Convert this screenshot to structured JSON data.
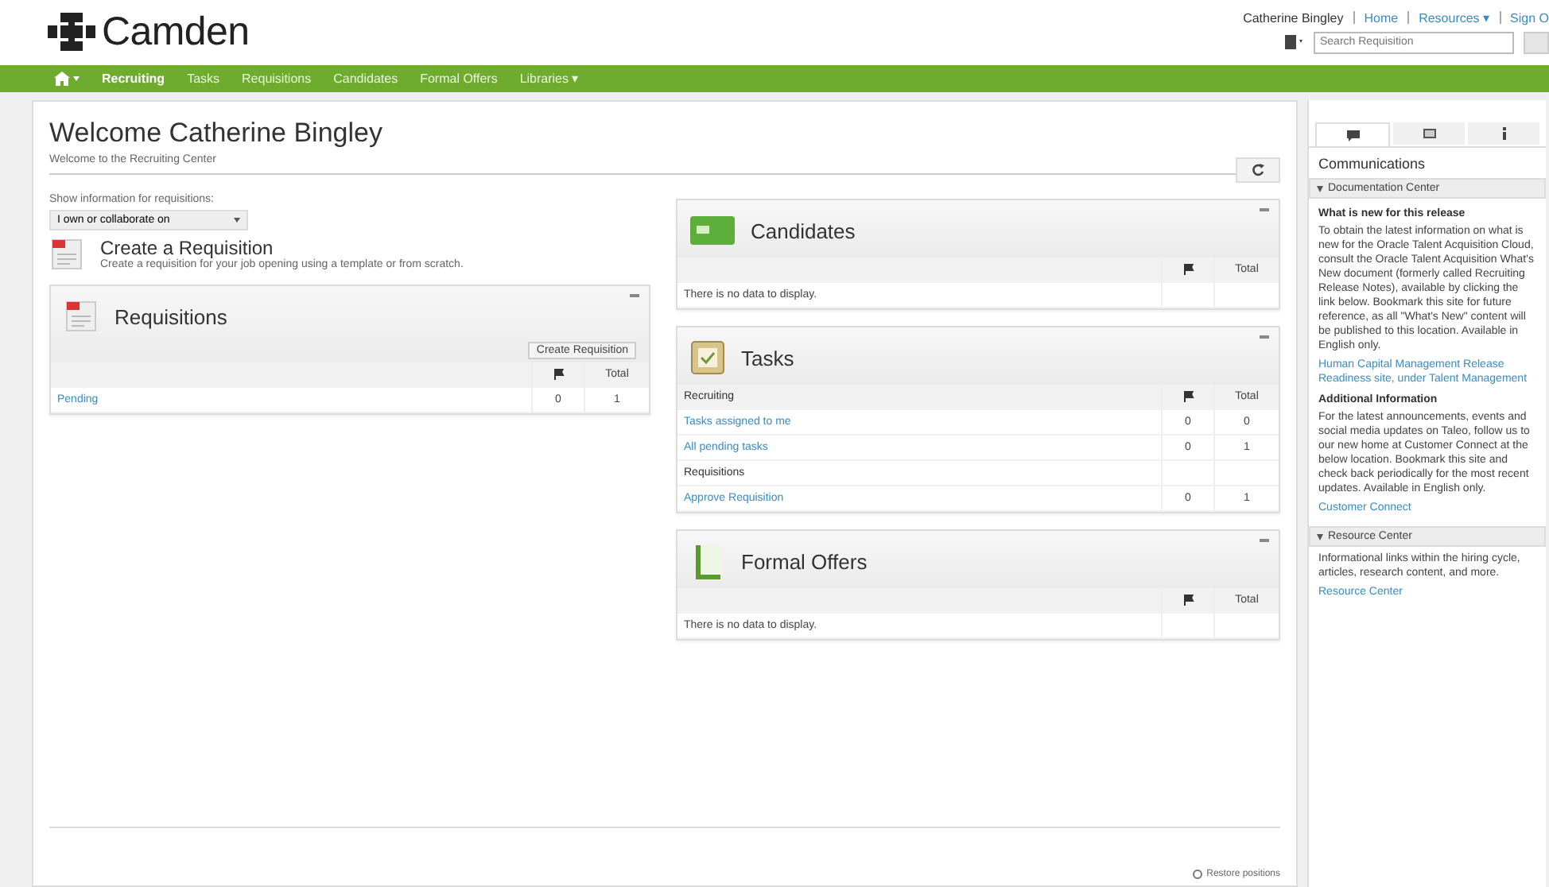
{
  "header": {
    "logo": "Camden",
    "user": "Catherine Bingley",
    "links": [
      "Home",
      "Resources ▾",
      "Sign O"
    ],
    "search": {
      "placeholder": "Search Requisition"
    }
  },
  "nav": [
    {
      "label": "Recruiting",
      "selected": true
    },
    {
      "label": "Tasks",
      "selected": false
    },
    {
      "label": "Requisitions",
      "selected": false
    },
    {
      "label": "Candidates",
      "selected": false
    },
    {
      "label": "Formal Offers",
      "selected": false
    },
    {
      "label": "Libraries ▾",
      "selected": false
    }
  ],
  "page": {
    "title": "Welcome Catherine Bingley",
    "subtitle": "Welcome to the Recruiting Center",
    "filter_label": "Show information for requisitions:",
    "filter_value": "I own or collaborate on",
    "create_title": "Create a Requisition",
    "create_description": "Create a requisition for your job opening using a template or from scratch.",
    "footer_link": "Restore positions"
  },
  "left_widgets": [
    {
      "kind": "requisitions",
      "title": "Requisitions",
      "action": "Create Requisition",
      "total_label": "Total",
      "rows": [
        {
          "kind": "link",
          "label": "Pending",
          "cells": [
            "0",
            "1"
          ]
        }
      ]
    }
  ],
  "right_widgets": [
    {
      "kind": "candidates",
      "title": "Candidates",
      "total_label": "Total",
      "empty_text": "There is no data to display."
    },
    {
      "kind": "tasks",
      "title": "Tasks",
      "total_label": "Total",
      "rows": [
        {
          "kind": "group",
          "label": "Recruiting"
        },
        {
          "kind": "link",
          "label": "Tasks assigned to me",
          "cells": [
            "0",
            "0"
          ]
        },
        {
          "kind": "link",
          "label": "All pending tasks",
          "cells": [
            "0",
            "1"
          ]
        },
        {
          "kind": "group",
          "label": "Requisitions"
        },
        {
          "kind": "link",
          "label": "Approve Requisition",
          "cells": [
            "0",
            "1"
          ]
        }
      ]
    },
    {
      "kind": "offers",
      "title": "Formal Offers",
      "total_label": "Total",
      "empty_text": "There is no data to display."
    }
  ],
  "sidebar": {
    "tabs": [
      {
        "kind": "chat",
        "selected": true
      },
      {
        "kind": "video",
        "selected": false
      },
      {
        "kind": "info",
        "selected": false
      }
    ],
    "title": "Communications",
    "sections": [
      {
        "title": "Documentation Center",
        "expanded": true,
        "blocks": [
          {
            "kind": "heading",
            "text": "What is new for this release"
          },
          {
            "kind": "text",
            "text": "To obtain the latest information on what is new for the Oracle Talent Acquisition Cloud, consult the Oracle Talent Acquisition What's New document (formerly called Recruiting Release Notes), available by clicking the link below. Bookmark this site for future reference, as all \"What's New\" content will be published to this location. Available in English only."
          },
          {
            "kind": "link",
            "text": "Human Capital Management Release Readiness site, under Talent Management"
          },
          {
            "kind": "heading",
            "text": "Additional Information"
          },
          {
            "kind": "text",
            "text": "For the latest announcements, events and social media updates on Taleo, follow us to our new home at Customer Connect at the below location. Bookmark this site and check back periodically for the most recent updates. Available in English only."
          },
          {
            "kind": "link",
            "text": "Customer Connect"
          }
        ]
      },
      {
        "title": "Resource Center",
        "expanded": true,
        "blocks": [
          {
            "kind": "text",
            "text": "Informational links within the hiring cycle, articles, research content, and more."
          },
          {
            "kind": "link",
            "text": "Resource Center"
          }
        ]
      }
    ]
  }
}
